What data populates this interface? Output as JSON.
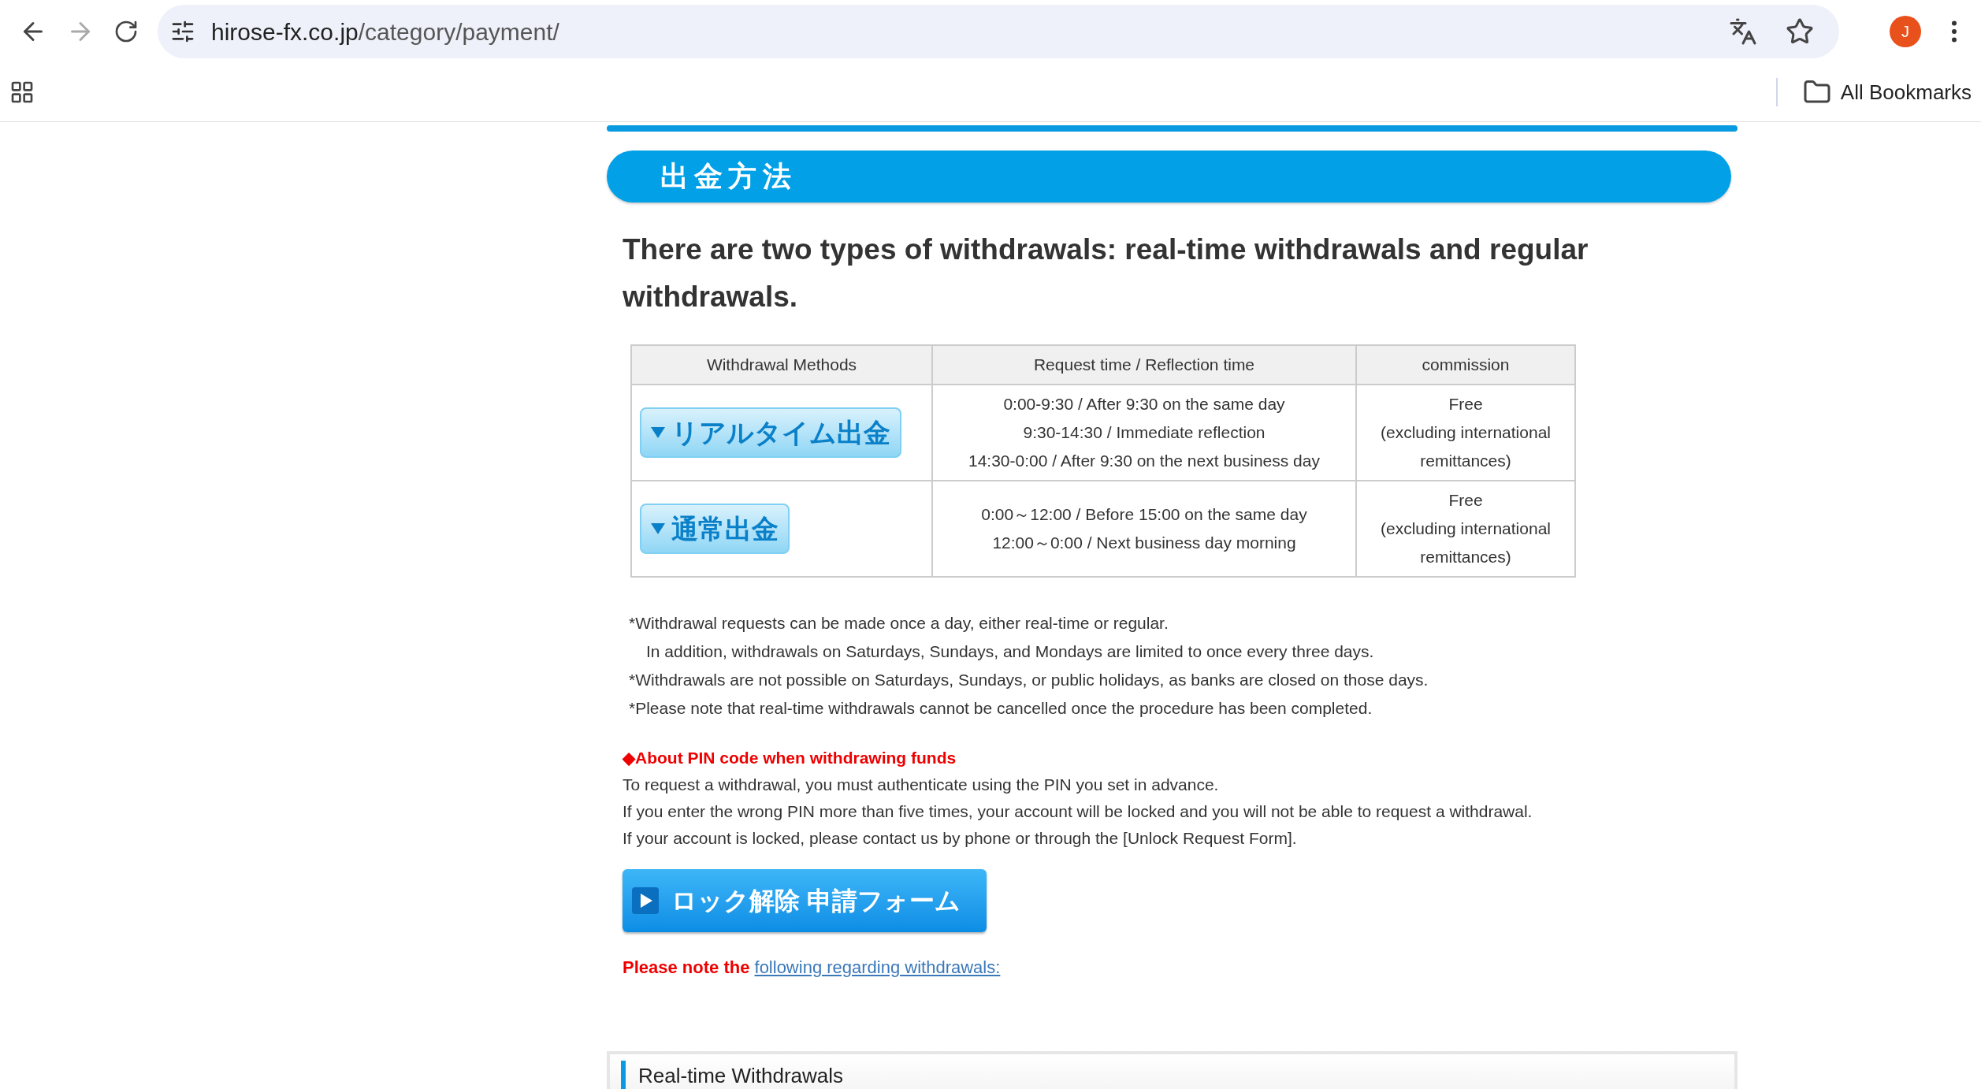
{
  "browser": {
    "url_host": "hirose-fx.co.jp",
    "url_path": "/category/payment/",
    "profile_initial": "J",
    "bookmarks_label": "All Bookmarks"
  },
  "section_title": "出金方法",
  "intro": "There are two types of withdrawals: real-time withdrawals and regular withdrawals.",
  "table": {
    "columns": [
      "Withdrawal Methods",
      "Request time / Reflection time",
      "commission"
    ],
    "rows": [
      {
        "method": "リアルタイム出金",
        "times": [
          "0:00-9:30 / After 9:30 on the same day",
          "9:30-14:30 / Immediate reflection",
          "14:30-0:00 / After 9:30 on the next business day"
        ],
        "commission": [
          "Free",
          "(excluding international",
          "remittances)"
        ]
      },
      {
        "method": "通常出金",
        "times": [
          "0:00～12:00 / Before 15:00 on the same day",
          "12:00～0:00 / Next business day morning"
        ],
        "commission": [
          "Free",
          "(excluding international",
          "remittances)"
        ]
      }
    ]
  },
  "notes": [
    {
      "text": "*Withdrawal requests can be made once a day, either real-time or regular.",
      "indented": false
    },
    {
      "text": "In addition, withdrawals on Saturdays, Sundays, and Mondays are limited to once every three days.",
      "indented": true
    },
    {
      "text": "*Withdrawals are not possible on Saturdays, Sundays, or public holidays, as banks are closed on those days.",
      "indented": false
    },
    {
      "text": "*Please note that real-time withdrawals cannot be cancelled once the procedure has been completed.",
      "indented": false
    }
  ],
  "pin": {
    "heading": "◆About PIN code when withdrawing funds",
    "lines": [
      "To request a withdrawal, you must authenticate using the PIN you set in advance.",
      "If you enter the wrong PIN more than five times, your account will be locked and you will not be able to request a withdrawal.",
      "If your account is locked, please contact us by phone or through the [Unlock Request Form]."
    ]
  },
  "unlock_button": "ロック解除 申請フォーム",
  "note": {
    "text": "Please note the",
    "link": "following regarding withdrawals:"
  },
  "subsection_title": "Real-time Withdrawals"
}
